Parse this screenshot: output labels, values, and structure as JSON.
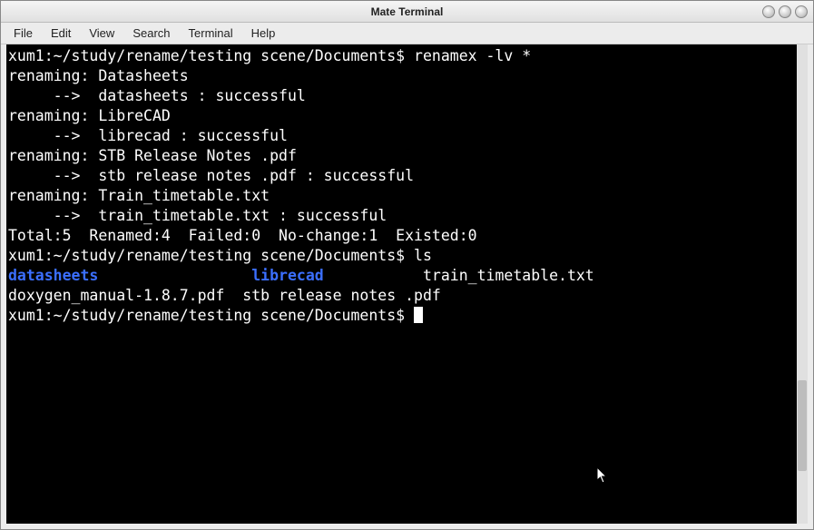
{
  "window": {
    "title": "Mate Terminal"
  },
  "menu": {
    "file": "File",
    "edit": "Edit",
    "view": "View",
    "search": "Search",
    "terminal": "Terminal",
    "help": "Help"
  },
  "term": {
    "l0": "xum1:~/study/rename/testing scene/Documents$ renamex -lv *",
    "l1": "renaming: Datasheets",
    "l2": "     -->  datasheets : successful",
    "l3": "renaming: LibreCAD",
    "l4": "     -->  librecad : successful",
    "l5": "renaming: STB Release Notes .pdf",
    "l6": "     -->  stb release notes .pdf : successful",
    "l7": "renaming: Train_timetable.txt",
    "l8": "     -->  train_timetable.txt : successful",
    "l9": "Total:5  Renamed:4  Failed:0  No-change:1  Existed:0",
    "l10": "xum1:~/study/rename/testing scene/Documents$ ls",
    "l11a": "datasheets",
    "l11pad1": "                 ",
    "l11b": "librecad",
    "l11pad2": "           ",
    "l11c": "train_timetable.txt",
    "l12": "doxygen_manual-1.8.7.pdf  stb release notes .pdf",
    "l13": "xum1:~/study/rename/testing scene/Documents$ "
  }
}
